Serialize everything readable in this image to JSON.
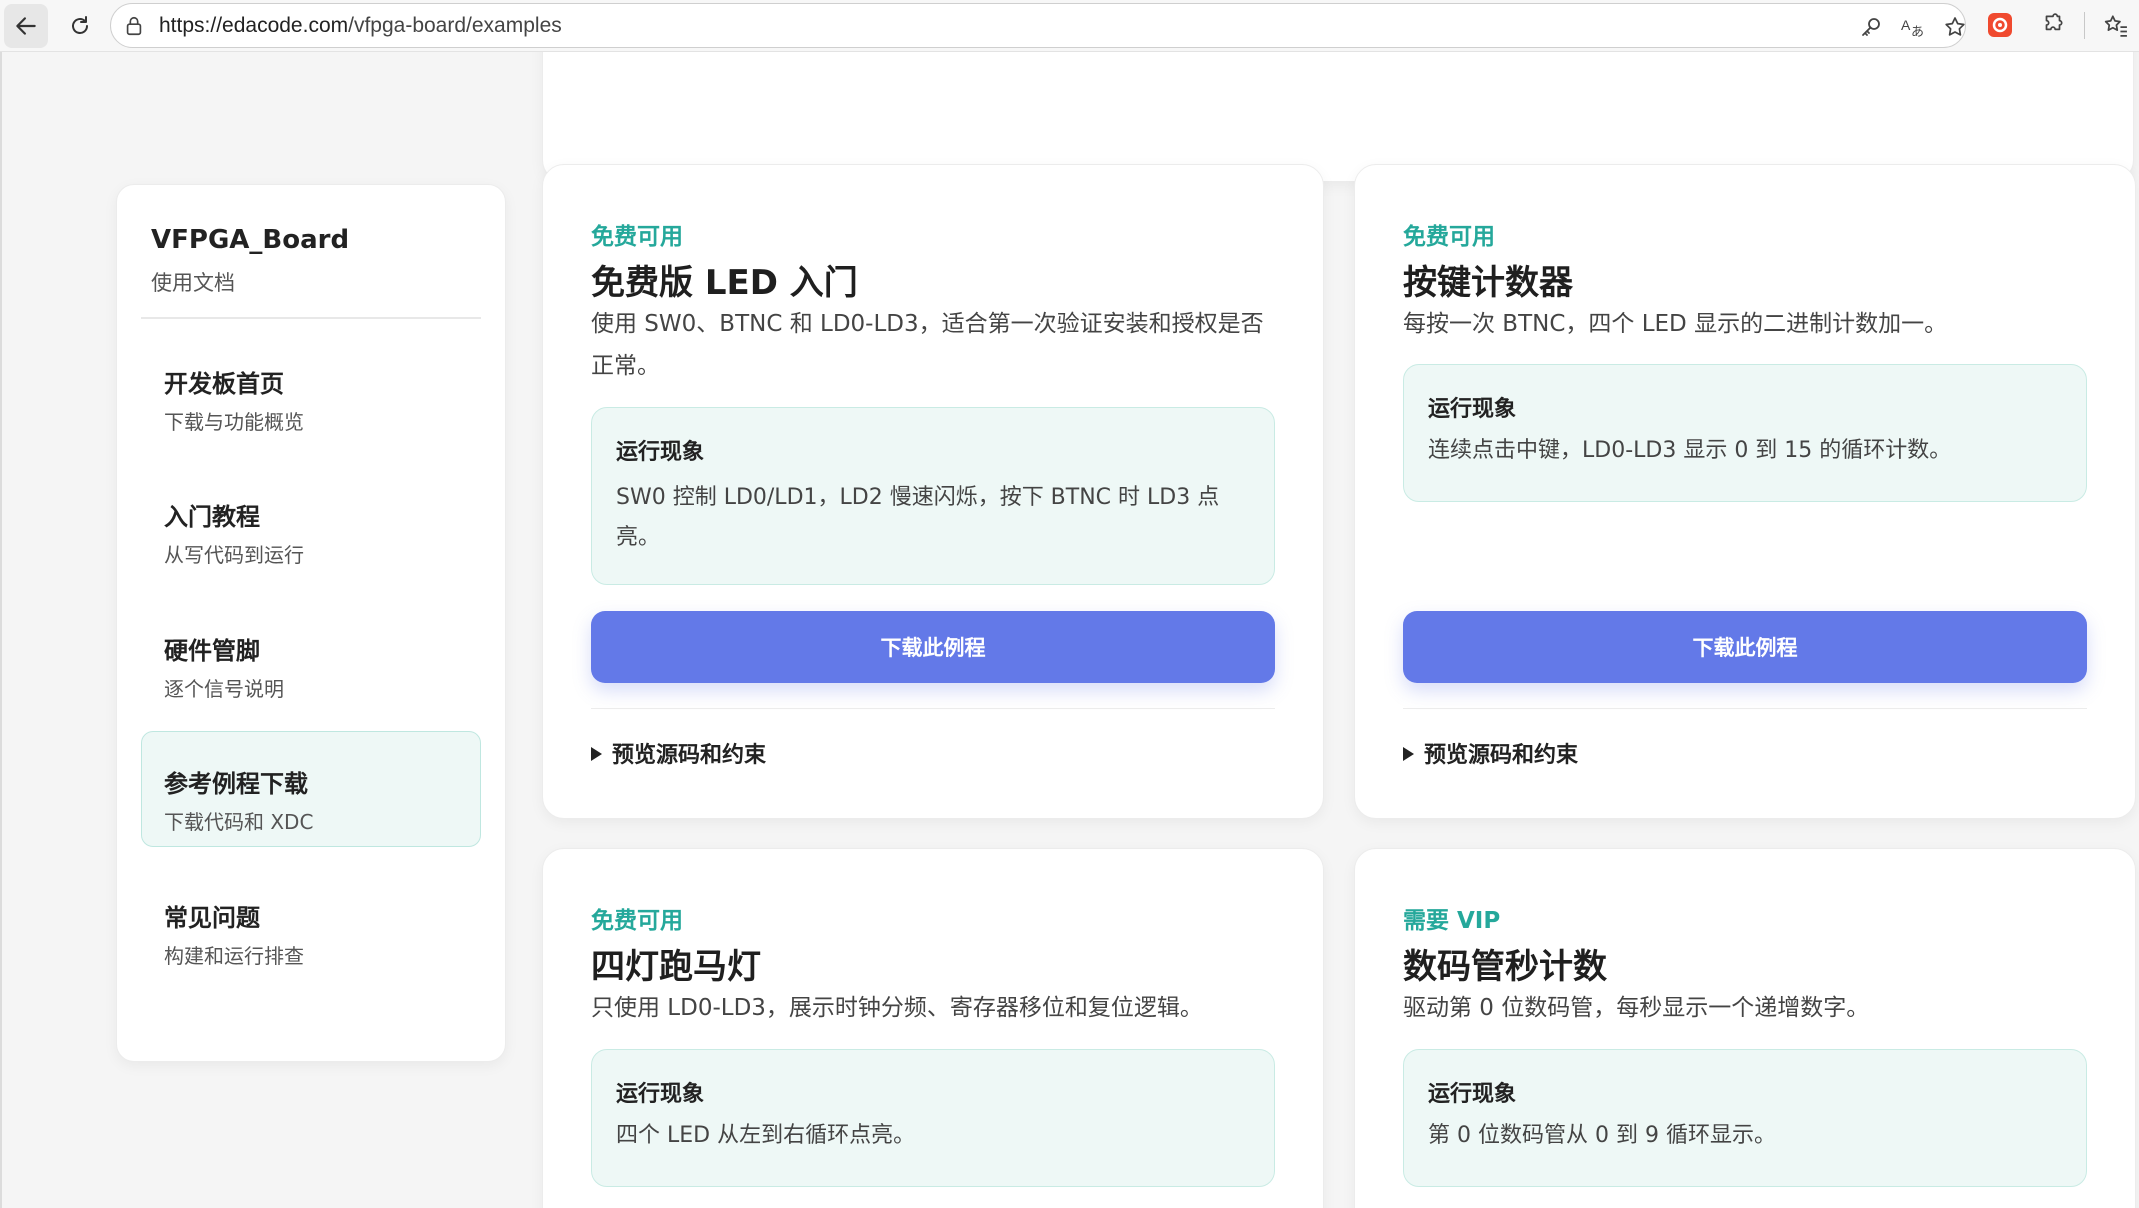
{
  "browser": {
    "url_host": "https://edacode.com",
    "url_path": "/vfpga-board/examples"
  },
  "sidebar": {
    "brand": "VFPGA_Board",
    "brand_sub": "使用文档",
    "items": [
      {
        "title": "开发板首页",
        "subtitle": "下载与功能概览"
      },
      {
        "title": "入门教程",
        "subtitle": "从写代码到运行"
      },
      {
        "title": "硬件管脚",
        "subtitle": "逐个信号说明"
      },
      {
        "title": "参考例程下载",
        "subtitle": "下载代码和 XDC"
      },
      {
        "title": "常见问题",
        "subtitle": "构建和运行排查"
      }
    ]
  },
  "cards": [
    {
      "tag": "免费可用",
      "title": "免费版 LED 入门",
      "desc": "使用 SW0、BTNC 和 LD0-LD3，适合第一次验证安装和授权是否正常。",
      "result_title": "运行现象",
      "result_text": "SW0 控制 LD0/LD1，LD2 慢速闪烁，按下 BTNC 时 LD3 点亮。",
      "button": "下载此例程",
      "preview": "预览源码和约束"
    },
    {
      "tag": "免费可用",
      "title": "按键计数器",
      "desc": "每按一次 BTNC，四个 LED 显示的二进制计数加一。",
      "result_title": "运行现象",
      "result_text": "连续点击中键，LD0-LD3 显示 0 到 15 的循环计数。",
      "button": "下载此例程",
      "preview": "预览源码和约束"
    },
    {
      "tag": "免费可用",
      "title": "四灯跑马灯",
      "desc": "只使用 LD0-LD3，展示时钟分频、寄存器移位和复位逻辑。",
      "result_title": "运行现象",
      "result_text": "四个 LED 从左到右循环点亮。"
    },
    {
      "tag": "需要 VIP",
      "title": "数码管秒计数",
      "desc": "驱动第 0 位数码管，每秒显示一个递增数字。",
      "result_title": "运行现象",
      "result_text": "第 0 位数码管从 0 到 9 循环显示。"
    }
  ]
}
